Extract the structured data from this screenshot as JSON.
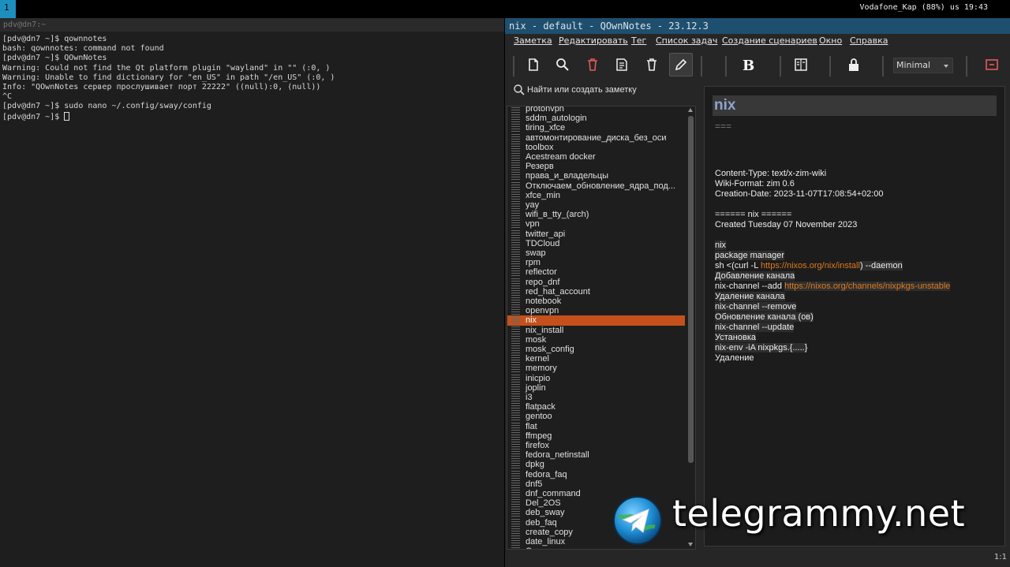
{
  "bar": {
    "workspace": "1",
    "status": "Vodafone_Kap (88%) us 19:43"
  },
  "terminal": {
    "title": "pdv@dn7:~",
    "lines": [
      "[pdv@dn7 ~]$ qownnotes",
      "bash: qownnotes: command not found",
      "[pdv@dn7 ~]$ QOwnNotes",
      "Warning: Could not find the Qt platform plugin \"wayland\" in \"\" (:0, )",
      "Warning: Unable to find dictionary for \"en_US\" in path \"/en_US\" (:0, )",
      "Info: \"QOwnNotes сервер прослушивает порт 22222\" ((null):0, (null))",
      "^C",
      "[pdv@dn7 ~]$ sudo nano ~/.config/sway/config",
      "[pdv@dn7 ~]$ "
    ]
  },
  "qownnotes": {
    "title": "nix - default - QOwnNotes - 23.12.3",
    "menu": [
      "Заметка",
      "Редактировать",
      "Тег",
      "Список задач",
      "Создание сценариев",
      "Окно",
      "Справка"
    ],
    "toolbar": {
      "icons": [
        "new-note-icon",
        "search-icon",
        "delete-note-icon",
        "edit-list-icon",
        "trash-icon",
        "pencil-icon",
        "bold-icon",
        "split-view-icon",
        "lock-icon",
        "close-panel-icon"
      ],
      "view_mode": "Minimal",
      "accent": "#e05a5a"
    },
    "search": {
      "placeholder": "Найти или создать заметку"
    },
    "notes": [
      "protonvpn",
      "sddm_autologin",
      "tiring_xfce",
      "автомонтирование_диска_без_оси",
      "toolbox",
      "Acestream docker",
      "Резерв",
      "права_и_владельцы",
      "Отключаем_обновление_ядра_под...",
      "xfce_min",
      "yay",
      "wifi_в_tty_(arch)",
      "vpn",
      "twitter_api",
      "TDCloud",
      "swap",
      "rpm",
      "reflector",
      "repo_dnf",
      "red_hat_account",
      "notebook",
      "openvpn",
      "nix",
      "nix_install",
      "mosk",
      "mosk_config",
      "kernel",
      "memory",
      "inicpio",
      "joplin",
      "i3",
      "flatpack",
      "gentoo",
      "flat",
      "ffmpeg",
      "firefox",
      "fedora_netinstall",
      "dpkg",
      "fedora_faq",
      "dnf5",
      "dnf_command",
      "Del_2OS",
      "deb_sway",
      "deb_faq",
      "create_copy",
      "date_linux",
      "Cens"
    ],
    "active_note_index": 22,
    "active_color": "#c4511b",
    "editor": {
      "heading": "nix",
      "underline": "===",
      "meta": [
        "Content-Type: text/x-zim-wiki",
        "Wiki-Format: zim 0.6",
        "Creation-Date: 2023-11-07T17:08:54+02:00"
      ],
      "zim_heading": "====== nix ======",
      "created": "Created Tuesday 07 November 2023",
      "body": {
        "l1": "nix",
        "l2": "package manager",
        "l3_pre": "sh <(curl -L ",
        "l3_link": "https://nixos.org/nix/install",
        "l3_post": ") --daemon",
        "l4": "Добавление канала",
        "l5_pre": "nix-channel --add ",
        "l5_link": "https://nixos.org/channels/nixpkgs-unstable",
        "l6": "Удаление канала",
        "l7": "nix-channel --remove",
        "l8": "Обновление канала (ов)",
        "l9": "nix-channel --update",
        "l10": "Установка",
        "l11": "nix-env -iA nixpkgs.{.....}",
        "l12": "Удаление"
      },
      "link_color": "#e07a1d"
    },
    "zoom": "1:1"
  },
  "watermark": {
    "text": "telegrammy.net"
  }
}
